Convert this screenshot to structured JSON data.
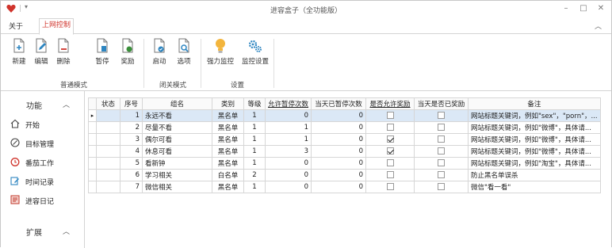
{
  "window": {
    "title": "进容盒子（全功能版）"
  },
  "menu": {
    "items": [
      "关于"
    ],
    "active_tab": "上网控制"
  },
  "ribbon": {
    "buttons": [
      {
        "label": "新建"
      },
      {
        "label": "编辑"
      },
      {
        "label": "删除"
      },
      {
        "label": "暂停"
      },
      {
        "label": "奖励"
      },
      {
        "label": "启动"
      },
      {
        "label": "选项"
      },
      {
        "label": "强力监控"
      },
      {
        "label": "监控设置"
      }
    ],
    "groups": [
      "普通模式",
      "闭关模式",
      "设置"
    ]
  },
  "sidebar": {
    "section1": "功能",
    "items": [
      {
        "label": "开始",
        "icon": "home-icon"
      },
      {
        "label": "目标管理",
        "icon": "target-icon"
      },
      {
        "label": "番茄工作",
        "icon": "clock-icon"
      },
      {
        "label": "时间记录",
        "icon": "edit-icon"
      },
      {
        "label": "进容日记",
        "icon": "diary-icon"
      }
    ],
    "section2": "扩展"
  },
  "grid": {
    "columns": [
      "状态",
      "序号",
      "组名",
      "类别",
      "等级",
      "允许暂停次数",
      "当天已暂停次数",
      "是否允许奖励",
      "当天是否已奖励",
      "备注"
    ],
    "rows": [
      {
        "status": "",
        "no": "1",
        "name": "永远不看",
        "cat": "黑名单",
        "level": "1",
        "pauses": "0",
        "paused": "0",
        "reward": false,
        "rewarded": false,
        "note": "网站标题关键词，例如\"sex\"，\"porn\"，..."
      },
      {
        "status": "",
        "no": "2",
        "name": "尽量不看",
        "cat": "黑名单",
        "level": "1",
        "pauses": "1",
        "paused": "0",
        "reward": false,
        "rewarded": false,
        "note": "网站标题关键词，例如\"微博\"，具体请..."
      },
      {
        "status": "",
        "no": "3",
        "name": "偶尔可看",
        "cat": "黑名单",
        "level": "1",
        "pauses": "1",
        "paused": "0",
        "reward": true,
        "rewarded": false,
        "note": "网站标题关键词，例如\"微博\"，具体请..."
      },
      {
        "status": "",
        "no": "4",
        "name": "休息可看",
        "cat": "黑名单",
        "level": "1",
        "pauses": "3",
        "paused": "0",
        "reward": true,
        "rewarded": false,
        "note": "网站标题关键词，例如\"微博\"，具体请..."
      },
      {
        "status": "",
        "no": "5",
        "name": "看新钟",
        "cat": "黑名单",
        "level": "1",
        "pauses": "0",
        "paused": "0",
        "reward": false,
        "rewarded": false,
        "note": "网站标题关键词，例如\"淘宝\"，具体请..."
      },
      {
        "status": "",
        "no": "6",
        "name": "学习相关",
        "cat": "白名单",
        "level": "2",
        "pauses": "0",
        "paused": "0",
        "reward": false,
        "rewarded": false,
        "note": "防止黑名单误杀"
      },
      {
        "status": "",
        "no": "7",
        "name": "微信相关",
        "cat": "黑名单",
        "level": "1",
        "pauses": "0",
        "paused": "0",
        "reward": false,
        "rewarded": false,
        "note": "微信\"看一看\""
      }
    ]
  }
}
